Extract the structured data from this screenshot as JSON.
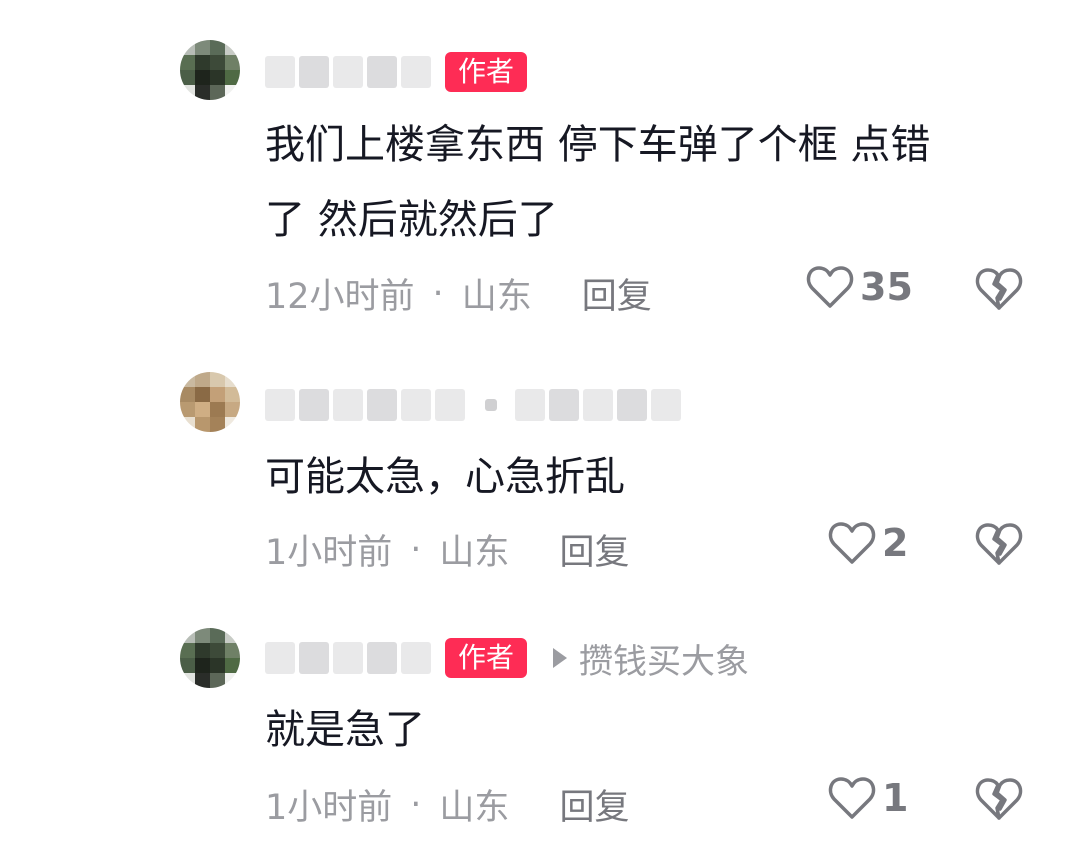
{
  "comments": [
    {
      "author_badge": "作者",
      "reply_to": "",
      "text_line1": "我们上楼拿东西 停下车弹了个框 点错",
      "text_line2": "了 然后就然后了",
      "time": "12小时前",
      "location": "山东",
      "reply_label": "回复",
      "likes": "35"
    },
    {
      "author_badge": "",
      "reply_to": "",
      "text_line1": "可能太急，心急折乱",
      "text_line2": "",
      "time": "1小时前",
      "location": "山东",
      "reply_label": "回复",
      "likes": "2"
    },
    {
      "author_badge": "作者",
      "reply_to": "攒钱买大象",
      "text_line1": "就是急了",
      "text_line2": "",
      "time": "1小时前",
      "location": "山东",
      "reply_label": "回复",
      "likes": "1"
    }
  ],
  "separator": "·",
  "colors": {
    "badge": "#fe2c55",
    "meta": "#9b9ca1",
    "text": "#161823"
  },
  "icons": {
    "like": "heart-outline-icon",
    "dislike": "broken-heart-icon"
  }
}
